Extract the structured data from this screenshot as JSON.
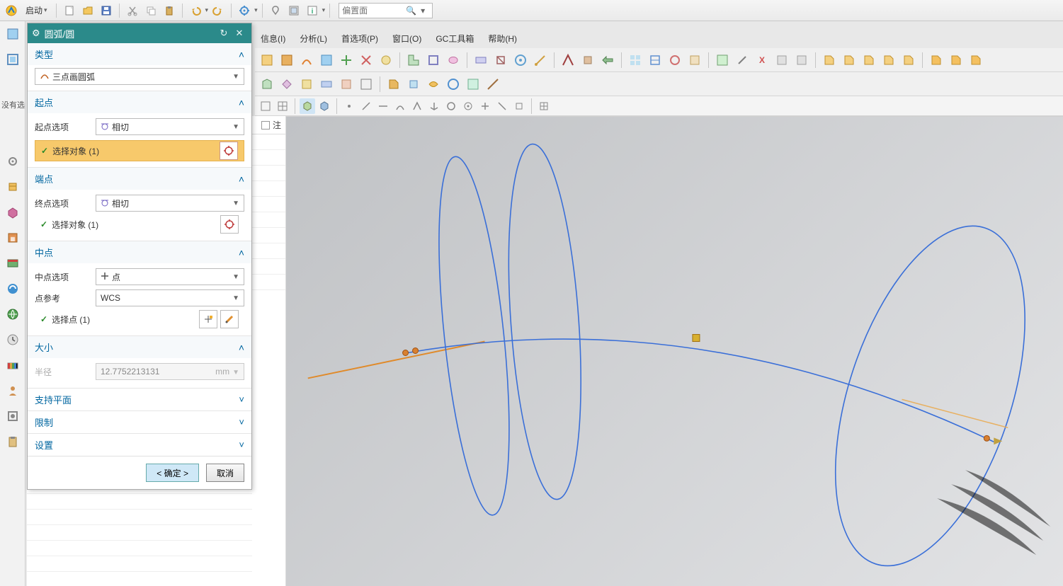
{
  "toolbar": {
    "start_label": "启动",
    "search_placeholder": "偏置面"
  },
  "menubar": {
    "info": "信息(I)",
    "analyze": "分析(L)",
    "preferences": "首选项(P)",
    "window": "窗口(O)",
    "gctoolbox": "GC工具箱",
    "help": "帮助(H)"
  },
  "status": {
    "no_selection": "没有选"
  },
  "part_nav": {
    "note_col": "注"
  },
  "dialog": {
    "title": "圆弧/圆",
    "sections": {
      "type": {
        "header": "类型",
        "option": "三点画圆弧"
      },
      "start": {
        "header": "起点",
        "option_label": "起点选项",
        "option_value": "相切",
        "select_object": "选择对象 (1)"
      },
      "end": {
        "header": "端点",
        "option_label": "终点选项",
        "option_value": "相切",
        "select_object": "选择对象 (1)"
      },
      "mid": {
        "header": "中点",
        "option_label": "中点选项",
        "option_value": "点",
        "ref_label": "点参考",
        "ref_value": "WCS",
        "select_point": "选择点 (1)"
      },
      "size": {
        "header": "大小",
        "radius_label": "半径",
        "radius_value": "12.7752213131",
        "radius_unit": "mm"
      },
      "support_plane": "支持平面",
      "limits": "限制",
      "settings": "设置"
    },
    "buttons": {
      "ok": "< 确定 >",
      "cancel": "取消"
    }
  },
  "colors": {
    "teal": "#2b8a8a",
    "link": "#0066a0",
    "highlight": "#f7c96b",
    "curve_blue": "#3a6fd8",
    "curve_orange": "#e08a2a"
  }
}
